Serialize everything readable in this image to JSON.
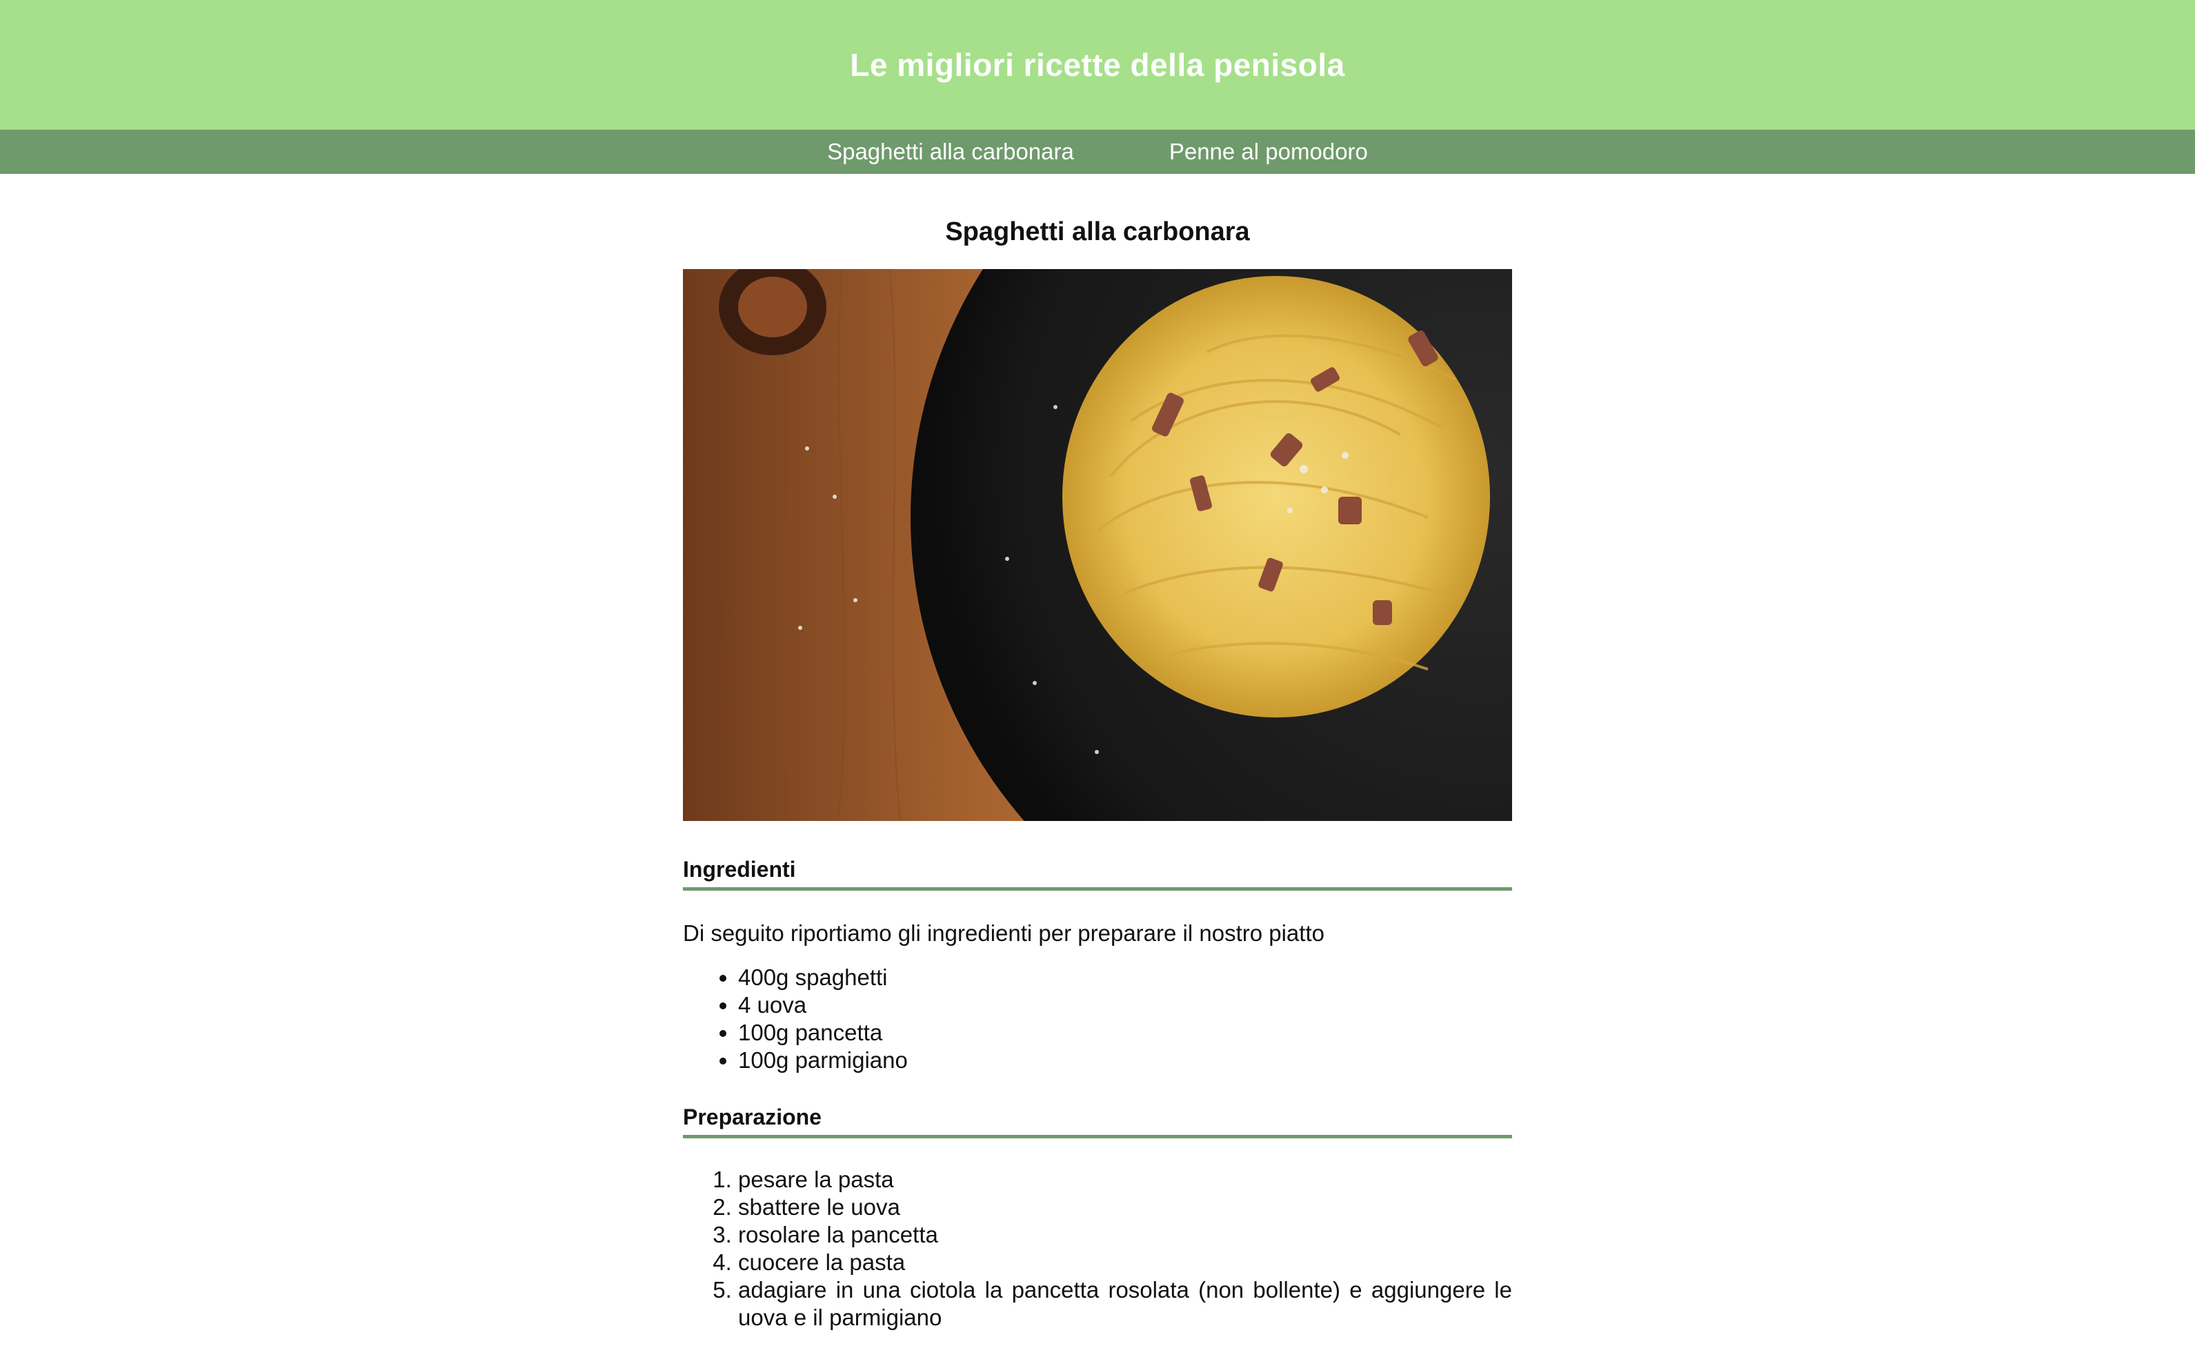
{
  "header": {
    "title": "Le migliori ricette della penisola"
  },
  "nav": {
    "items": [
      {
        "label": "Spaghetti alla carbonara"
      },
      {
        "label": "Penne al pomodoro"
      }
    ]
  },
  "recipe": {
    "title": "Spaghetti alla carbonara",
    "image": "carbonara-photo",
    "ingredients_heading": "Ingredienti",
    "ingredients_intro": "Di seguito riportiamo gli ingredienti per preparare il nostro piatto",
    "ingredients": [
      "400g spaghetti",
      "4 uova",
      "100g pancetta",
      "100g parmigiano"
    ],
    "preparation_heading": "Preparazione",
    "steps": [
      "pesare la pasta",
      "sbattere le uova",
      "rosolare la pancetta",
      "cuocere la pasta",
      "adagiare in una ciotola la pancetta rosolata (non bollente) e aggiungere le uova e il parmigiano"
    ]
  },
  "colors": {
    "header_bg": "#a6e08b",
    "nav_bg": "#6f9a6b",
    "accent_rule": "#6f9a6b"
  }
}
